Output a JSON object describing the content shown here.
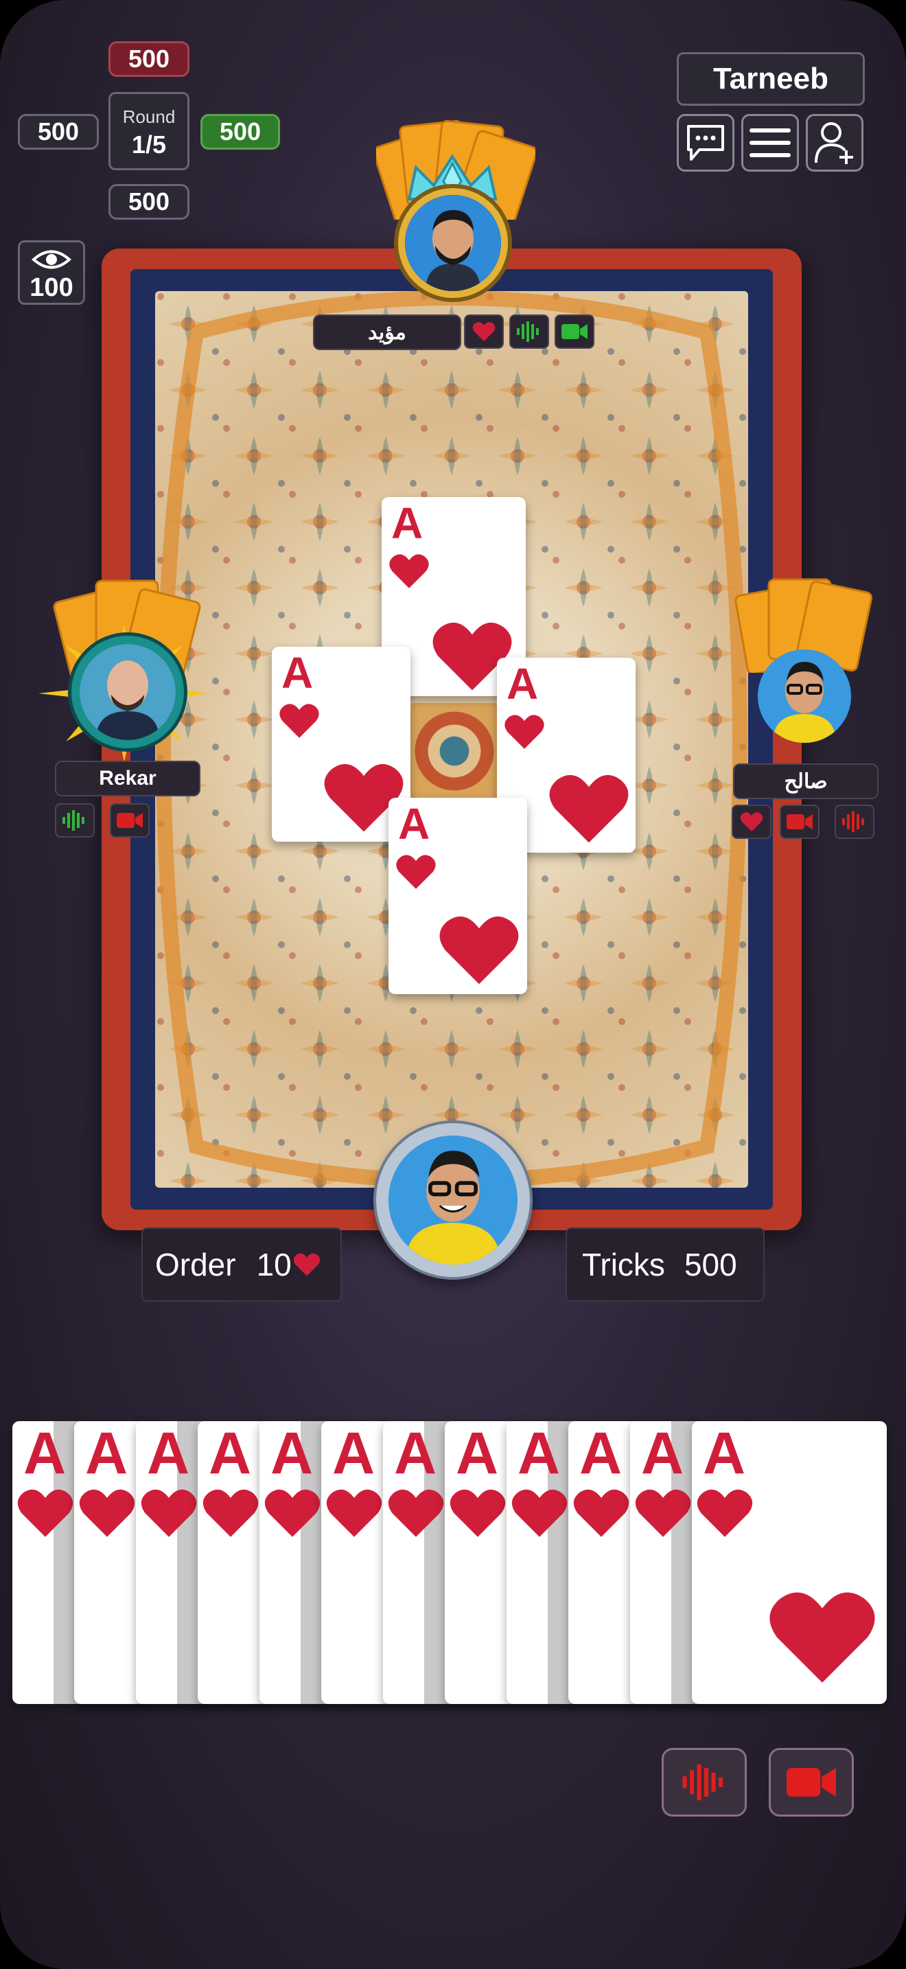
{
  "header": {
    "game_title": "Tarneeb",
    "round_label": "Round",
    "round_value": "1/5",
    "scores": {
      "top": "500",
      "left": "500",
      "right": "500",
      "bottom": "500"
    },
    "spectators": "100"
  },
  "players": {
    "top": {
      "name": "مؤيد"
    },
    "left": {
      "name": "Rekar"
    },
    "right": {
      "name": "صالح"
    }
  },
  "status": {
    "order_label": "Order",
    "order_value": "10",
    "tricks_label": "Tricks",
    "tricks_value": "500"
  },
  "table_cards": [
    {
      "rank": "A",
      "suit": "hearts"
    },
    {
      "rank": "A",
      "suit": "hearts"
    },
    {
      "rank": "A",
      "suit": "hearts"
    },
    {
      "rank": "A",
      "suit": "hearts"
    }
  ],
  "hand": [
    {
      "rank": "A"
    },
    {
      "rank": "A"
    },
    {
      "rank": "A"
    },
    {
      "rank": "A"
    },
    {
      "rank": "A"
    },
    {
      "rank": "A"
    },
    {
      "rank": "A"
    },
    {
      "rank": "A"
    },
    {
      "rank": "A"
    },
    {
      "rank": "A"
    },
    {
      "rank": "A"
    },
    {
      "rank": "A"
    }
  ],
  "colors": {
    "suit_red": "#d01e3a",
    "accent_gold": "#f0a020",
    "mic_on": "#2fb83a",
    "mic_off": "#d82020"
  },
  "icons": [
    "chat-icon",
    "menu-icon",
    "add-user-icon",
    "eye-icon",
    "heart-icon",
    "voice-icon",
    "video-icon"
  ]
}
